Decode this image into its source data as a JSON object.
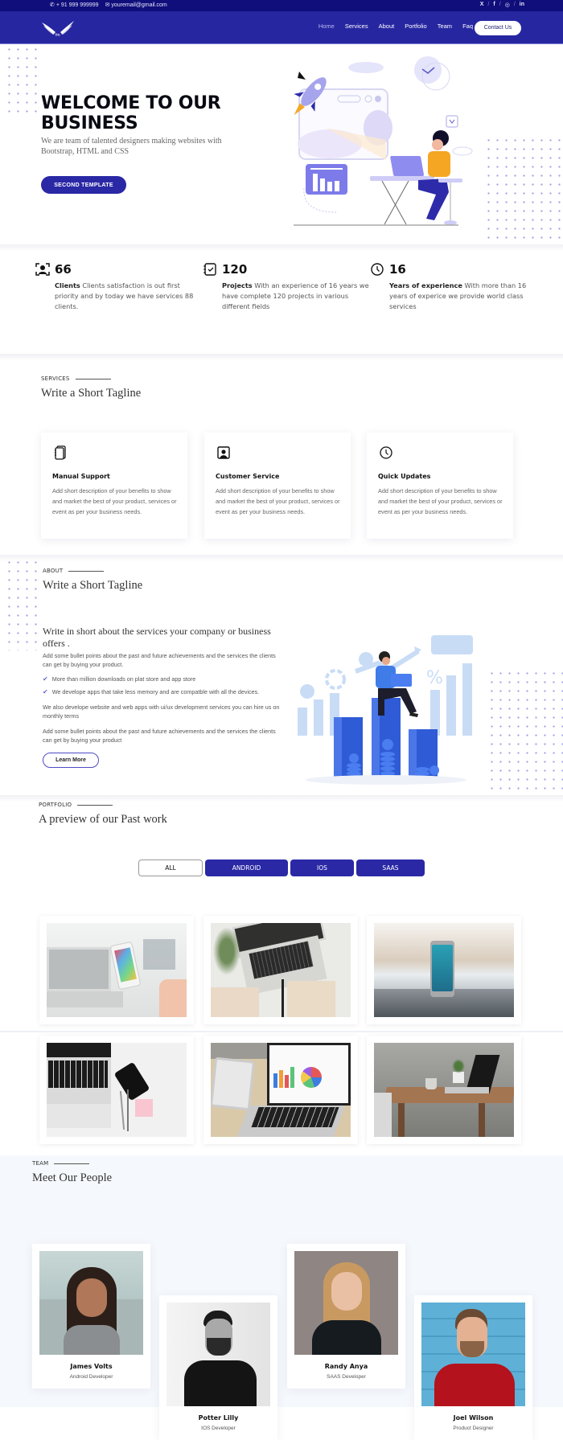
{
  "topbar": {
    "phone": "+ 91 999 999999",
    "email": "youremail@gmail.com",
    "social": [
      {
        "icon": "x-twitter-icon",
        "label": "X"
      },
      {
        "icon": "facebook-icon",
        "label": "f"
      },
      {
        "icon": "instagram-icon",
        "label": "◎"
      },
      {
        "icon": "linkedin-icon",
        "label": "in"
      }
    ]
  },
  "nav": {
    "logo": "wings-logo",
    "links": [
      "Home",
      "Services",
      "About",
      "Portfolio",
      "Team",
      "Faq"
    ],
    "active": "Home",
    "cta": "Contact Us"
  },
  "hero": {
    "title": "WELCOME TO OUR BUSINESS",
    "subtitle": "We are team of talented designers making websites with Bootstrap, HTML and CSS",
    "button": "SECOND TEMPLATE"
  },
  "stats": [
    {
      "icon": "client-icon",
      "number": "66",
      "label": "Clients",
      "text": "Clients satisfaction is out first priority and by today we have services 88 clients."
    },
    {
      "icon": "checklist-icon",
      "number": "120",
      "label": "Projects",
      "text": "With an experience of 16 years we have complete 120 projects in various different fields"
    },
    {
      "icon": "clock-icon",
      "number": "16",
      "label": "Years of experience",
      "text": "With more than 16 years of experice we provide world class services"
    }
  ],
  "services": {
    "eyebrow": "SERVICES",
    "tagline": "Write a Short Tagline",
    "cards": [
      {
        "icon": "notebook-icon",
        "title": "Manual Support",
        "text": "Add short description of your benefits to show and market the best of your product, services or event as per your business needs."
      },
      {
        "icon": "contact-card-icon",
        "title": "Customer Service",
        "text": "Add short description of your benefits to show and market the best of your product, services or event as per your business needs."
      },
      {
        "icon": "clock-icon",
        "title": "Quick Updates",
        "text": "Add short description of your benefits to show and market the best of your product, services or event as per your business needs."
      }
    ]
  },
  "about": {
    "eyebrow": "ABOUT",
    "tagline": "Write a Short Tagline",
    "subheading": "Write in short about the services your company or business offers .",
    "para1": "Add some bullet points about the past and future achievements and the services the clients can get by buying your product.",
    "bullets": [
      "More than million downloads on plat store and app store",
      "We develope apps that take less memory and are compatble with all the devices."
    ],
    "para2": "We also develope website and web apps with ui/ux development services you can hire us on monthly terms",
    "para3": "Add some bullet points about the past and future achievements and the services the clients can get by buying your product",
    "button": "Learn More"
  },
  "portfolio": {
    "eyebrow": "PORTFOLIO",
    "tagline": "A preview of our Past work",
    "filters": [
      "ALL",
      "ANDROID",
      "IOS",
      "SAAS"
    ],
    "active_filter": "ALL",
    "items": [
      {
        "alt": "Hand holding iPhone in front of laptop"
      },
      {
        "alt": "Hands typing on laptop with plant"
      },
      {
        "alt": "Android phone standing on wooden table"
      },
      {
        "alt": "Laptop, phone and pens on white desk"
      },
      {
        "alt": "Laptop and tablet showing charts"
      },
      {
        "alt": "Laptop on wooden desk with cup and plant"
      }
    ]
  },
  "team": {
    "eyebrow": "TEAM",
    "tagline": "Meet Our People",
    "members": [
      {
        "name": "James Volts",
        "role": "Android Developer"
      },
      {
        "name": "Potter Lilly",
        "role": "IOS Developer"
      },
      {
        "name": "Randy Anya",
        "role": "SAAS Developer"
      },
      {
        "name": "Joel Wilson",
        "role": "Product Designer"
      }
    ]
  },
  "colors": {
    "topbar": "#0f0e7a",
    "nav": "#2726a1",
    "primary": "#2a28a5",
    "accent_light": "#9b98e0"
  }
}
